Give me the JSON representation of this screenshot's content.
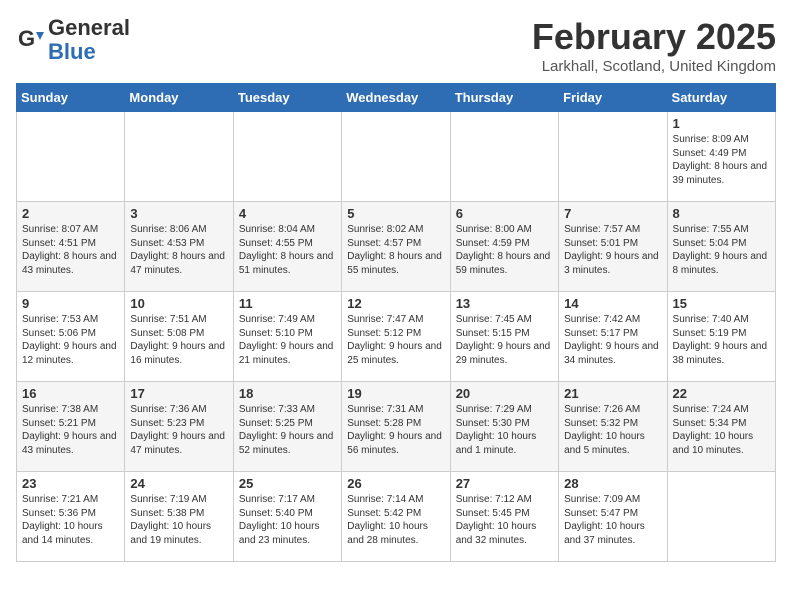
{
  "header": {
    "logo_general": "General",
    "logo_blue": "Blue",
    "month": "February 2025",
    "location": "Larkhall, Scotland, United Kingdom"
  },
  "days_of_week": [
    "Sunday",
    "Monday",
    "Tuesday",
    "Wednesday",
    "Thursday",
    "Friday",
    "Saturday"
  ],
  "weeks": [
    [
      {
        "day": "",
        "info": ""
      },
      {
        "day": "",
        "info": ""
      },
      {
        "day": "",
        "info": ""
      },
      {
        "day": "",
        "info": ""
      },
      {
        "day": "",
        "info": ""
      },
      {
        "day": "",
        "info": ""
      },
      {
        "day": "1",
        "info": "Sunrise: 8:09 AM\nSunset: 4:49 PM\nDaylight: 8 hours and 39 minutes."
      }
    ],
    [
      {
        "day": "2",
        "info": "Sunrise: 8:07 AM\nSunset: 4:51 PM\nDaylight: 8 hours and 43 minutes."
      },
      {
        "day": "3",
        "info": "Sunrise: 8:06 AM\nSunset: 4:53 PM\nDaylight: 8 hours and 47 minutes."
      },
      {
        "day": "4",
        "info": "Sunrise: 8:04 AM\nSunset: 4:55 PM\nDaylight: 8 hours and 51 minutes."
      },
      {
        "day": "5",
        "info": "Sunrise: 8:02 AM\nSunset: 4:57 PM\nDaylight: 8 hours and 55 minutes."
      },
      {
        "day": "6",
        "info": "Sunrise: 8:00 AM\nSunset: 4:59 PM\nDaylight: 8 hours and 59 minutes."
      },
      {
        "day": "7",
        "info": "Sunrise: 7:57 AM\nSunset: 5:01 PM\nDaylight: 9 hours and 3 minutes."
      },
      {
        "day": "8",
        "info": "Sunrise: 7:55 AM\nSunset: 5:04 PM\nDaylight: 9 hours and 8 minutes."
      }
    ],
    [
      {
        "day": "9",
        "info": "Sunrise: 7:53 AM\nSunset: 5:06 PM\nDaylight: 9 hours and 12 minutes."
      },
      {
        "day": "10",
        "info": "Sunrise: 7:51 AM\nSunset: 5:08 PM\nDaylight: 9 hours and 16 minutes."
      },
      {
        "day": "11",
        "info": "Sunrise: 7:49 AM\nSunset: 5:10 PM\nDaylight: 9 hours and 21 minutes."
      },
      {
        "day": "12",
        "info": "Sunrise: 7:47 AM\nSunset: 5:12 PM\nDaylight: 9 hours and 25 minutes."
      },
      {
        "day": "13",
        "info": "Sunrise: 7:45 AM\nSunset: 5:15 PM\nDaylight: 9 hours and 29 minutes."
      },
      {
        "day": "14",
        "info": "Sunrise: 7:42 AM\nSunset: 5:17 PM\nDaylight: 9 hours and 34 minutes."
      },
      {
        "day": "15",
        "info": "Sunrise: 7:40 AM\nSunset: 5:19 PM\nDaylight: 9 hours and 38 minutes."
      }
    ],
    [
      {
        "day": "16",
        "info": "Sunrise: 7:38 AM\nSunset: 5:21 PM\nDaylight: 9 hours and 43 minutes."
      },
      {
        "day": "17",
        "info": "Sunrise: 7:36 AM\nSunset: 5:23 PM\nDaylight: 9 hours and 47 minutes."
      },
      {
        "day": "18",
        "info": "Sunrise: 7:33 AM\nSunset: 5:25 PM\nDaylight: 9 hours and 52 minutes."
      },
      {
        "day": "19",
        "info": "Sunrise: 7:31 AM\nSunset: 5:28 PM\nDaylight: 9 hours and 56 minutes."
      },
      {
        "day": "20",
        "info": "Sunrise: 7:29 AM\nSunset: 5:30 PM\nDaylight: 10 hours and 1 minute."
      },
      {
        "day": "21",
        "info": "Sunrise: 7:26 AM\nSunset: 5:32 PM\nDaylight: 10 hours and 5 minutes."
      },
      {
        "day": "22",
        "info": "Sunrise: 7:24 AM\nSunset: 5:34 PM\nDaylight: 10 hours and 10 minutes."
      }
    ],
    [
      {
        "day": "23",
        "info": "Sunrise: 7:21 AM\nSunset: 5:36 PM\nDaylight: 10 hours and 14 minutes."
      },
      {
        "day": "24",
        "info": "Sunrise: 7:19 AM\nSunset: 5:38 PM\nDaylight: 10 hours and 19 minutes."
      },
      {
        "day": "25",
        "info": "Sunrise: 7:17 AM\nSunset: 5:40 PM\nDaylight: 10 hours and 23 minutes."
      },
      {
        "day": "26",
        "info": "Sunrise: 7:14 AM\nSunset: 5:42 PM\nDaylight: 10 hours and 28 minutes."
      },
      {
        "day": "27",
        "info": "Sunrise: 7:12 AM\nSunset: 5:45 PM\nDaylight: 10 hours and 32 minutes."
      },
      {
        "day": "28",
        "info": "Sunrise: 7:09 AM\nSunset: 5:47 PM\nDaylight: 10 hours and 37 minutes."
      },
      {
        "day": "",
        "info": ""
      }
    ]
  ]
}
